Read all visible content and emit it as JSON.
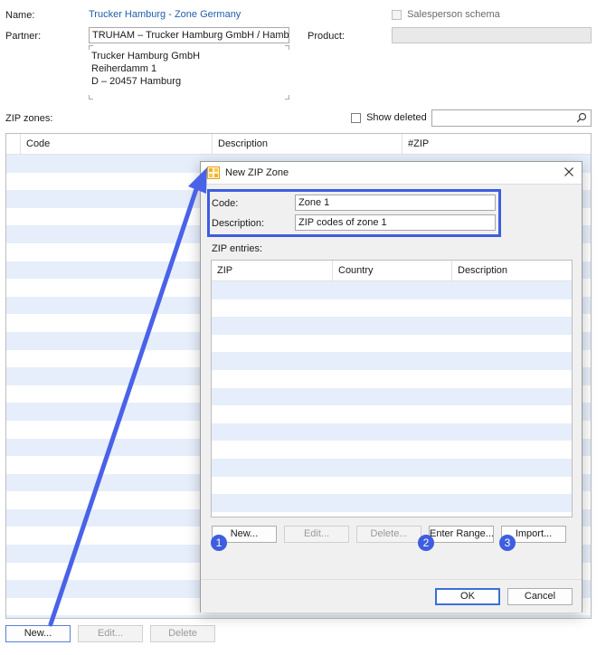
{
  "form": {
    "name_label": "Name:",
    "name_value": "Trucker Hamburg - Zone Germany",
    "salesperson_label": "Salesperson schema",
    "partner_label": "Partner:",
    "partner_value": "TRUHAM – Trucker Hamburg GmbH / Hambu",
    "product_label": "Product:",
    "address_lines": [
      "Trucker Hamburg GmbH",
      "Reiherdamm 1",
      "D – 20457 Hamburg"
    ],
    "zip_zones_label": "ZIP zones:",
    "show_deleted_label": "Show deleted",
    "search_value": ""
  },
  "zones_table": {
    "columns": [
      "Code",
      "Description",
      "#ZIP"
    ],
    "rows": []
  },
  "bottom_buttons": {
    "new": "New...",
    "edit": "Edit...",
    "delete": "Delete"
  },
  "dialog": {
    "title": "New ZIP Zone",
    "code_label": "Code:",
    "code_value": "Zone 1",
    "description_label": "Description:",
    "description_value": "ZIP codes of zone 1",
    "zip_entries_label": "ZIP entries:",
    "columns": [
      "ZIP",
      "Country",
      "Description"
    ],
    "buttons": {
      "new": "New...",
      "edit": "Edit...",
      "delete": "Delete...",
      "enter_range": "Enter Range...",
      "import": "Import...",
      "ok": "OK",
      "cancel": "Cancel"
    },
    "badges": [
      "1",
      "2",
      "3"
    ]
  },
  "annotation": {
    "highlight_color": "#3e5de0",
    "arrow_color": "#4a62e8"
  },
  "icons": {
    "search": "search-icon",
    "close": "close-icon",
    "dialog_app": "zip-zone-app-icon"
  }
}
